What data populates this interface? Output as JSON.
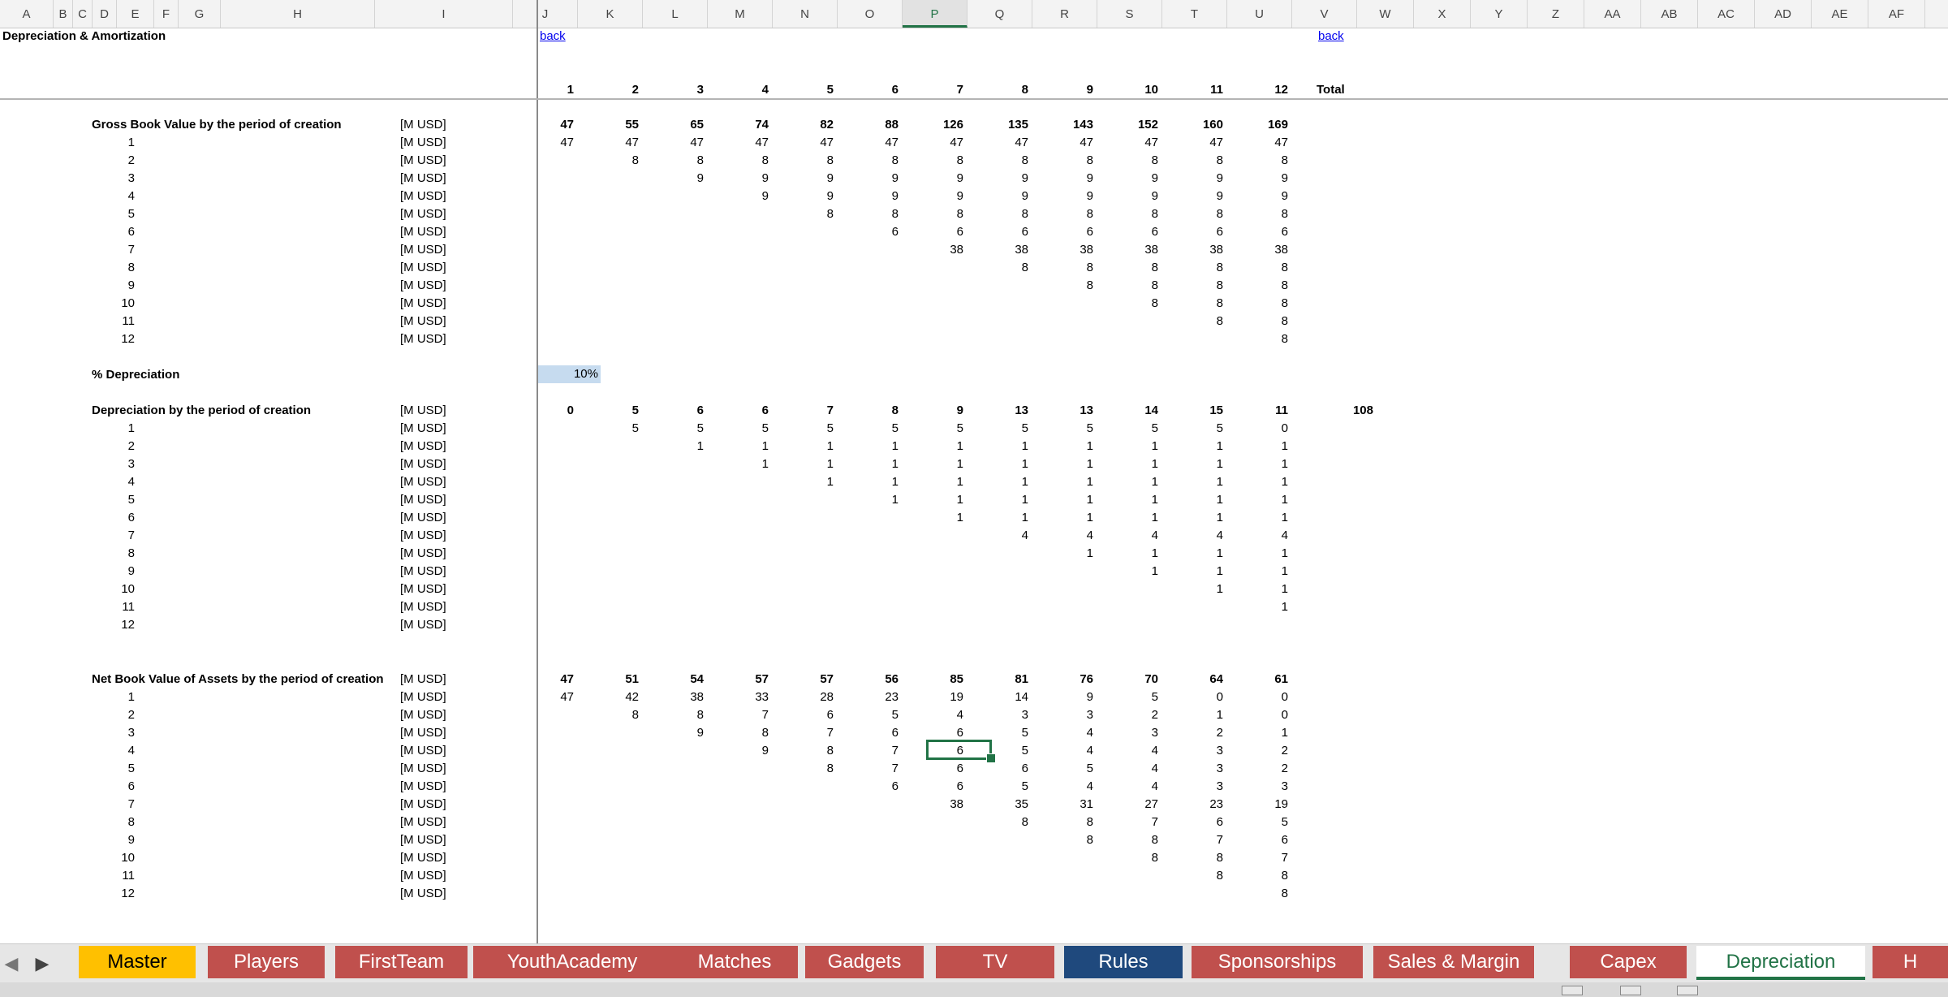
{
  "columns": [
    "A",
    "B",
    "C",
    "D",
    "E",
    "F",
    "G",
    "H",
    "I",
    "J",
    "K",
    "L",
    "M",
    "N",
    "O",
    "P",
    "Q",
    "R",
    "S",
    "T",
    "U",
    "V",
    "W",
    "X",
    "Y",
    "Z",
    "AA",
    "AB",
    "AC",
    "AD",
    "AE",
    "AF"
  ],
  "selected_column": "P",
  "header": {
    "title": "Depreciation & Amortization",
    "back_link_1": "back",
    "back_link_2": "back",
    "periods": [
      "1",
      "2",
      "3",
      "4",
      "5",
      "6",
      "7",
      "8",
      "9",
      "10",
      "11",
      "12"
    ],
    "total_label": "Total"
  },
  "sections": {
    "gross": {
      "title": "Gross Book Value by the period of creation",
      "units": "[M USD]",
      "totals": [
        "47",
        "55",
        "65",
        "74",
        "82",
        "88",
        "126",
        "135",
        "143",
        "152",
        "160",
        "169"
      ],
      "rows": [
        {
          "label": "1",
          "units": "[M USD]",
          "values": [
            "47",
            "47",
            "47",
            "47",
            "47",
            "47",
            "47",
            "47",
            "47",
            "47",
            "47",
            "47"
          ]
        },
        {
          "label": "2",
          "units": "[M USD]",
          "values": [
            "",
            "8",
            "8",
            "8",
            "8",
            "8",
            "8",
            "8",
            "8",
            "8",
            "8",
            "8"
          ]
        },
        {
          "label": "3",
          "units": "[M USD]",
          "values": [
            "",
            "",
            "9",
            "9",
            "9",
            "9",
            "9",
            "9",
            "9",
            "9",
            "9",
            "9"
          ]
        },
        {
          "label": "4",
          "units": "[M USD]",
          "values": [
            "",
            "",
            "",
            "9",
            "9",
            "9",
            "9",
            "9",
            "9",
            "9",
            "9",
            "9"
          ]
        },
        {
          "label": "5",
          "units": "[M USD]",
          "values": [
            "",
            "",
            "",
            "",
            "8",
            "8",
            "8",
            "8",
            "8",
            "8",
            "8",
            "8"
          ]
        },
        {
          "label": "6",
          "units": "[M USD]",
          "values": [
            "",
            "",
            "",
            "",
            "",
            "6",
            "6",
            "6",
            "6",
            "6",
            "6",
            "6"
          ]
        },
        {
          "label": "7",
          "units": "[M USD]",
          "values": [
            "",
            "",
            "",
            "",
            "",
            "",
            "38",
            "38",
            "38",
            "38",
            "38",
            "38"
          ]
        },
        {
          "label": "8",
          "units": "[M USD]",
          "values": [
            "",
            "",
            "",
            "",
            "",
            "",
            "",
            "8",
            "8",
            "8",
            "8",
            "8"
          ]
        },
        {
          "label": "9",
          "units": "[M USD]",
          "values": [
            "",
            "",
            "",
            "",
            "",
            "",
            "",
            "",
            "8",
            "8",
            "8",
            "8"
          ]
        },
        {
          "label": "10",
          "units": "[M USD]",
          "values": [
            "",
            "",
            "",
            "",
            "",
            "",
            "",
            "",
            "",
            "8",
            "8",
            "8"
          ]
        },
        {
          "label": "11",
          "units": "[M USD]",
          "values": [
            "",
            "",
            "",
            "",
            "",
            "",
            "",
            "",
            "",
            "",
            "8",
            "8"
          ]
        },
        {
          "label": "12",
          "units": "[M USD]",
          "values": [
            "",
            "",
            "",
            "",
            "",
            "",
            "",
            "",
            "",
            "",
            "",
            "8"
          ]
        }
      ]
    },
    "pct": {
      "title": "% Depreciation",
      "value": "10%"
    },
    "dep": {
      "title": "Depreciation by the period of creation",
      "units": "[M USD]",
      "totals": [
        "0",
        "5",
        "6",
        "6",
        "7",
        "8",
        "9",
        "13",
        "13",
        "14",
        "15",
        "11"
      ],
      "grand_total": "108",
      "rows": [
        {
          "label": "1",
          "units": "[M USD]",
          "values": [
            "",
            "5",
            "5",
            "5",
            "5",
            "5",
            "5",
            "5",
            "5",
            "5",
            "5",
            "0"
          ]
        },
        {
          "label": "2",
          "units": "[M USD]",
          "values": [
            "",
            "",
            "1",
            "1",
            "1",
            "1",
            "1",
            "1",
            "1",
            "1",
            "1",
            "1"
          ]
        },
        {
          "label": "3",
          "units": "[M USD]",
          "values": [
            "",
            "",
            "",
            "1",
            "1",
            "1",
            "1",
            "1",
            "1",
            "1",
            "1",
            "1"
          ]
        },
        {
          "label": "4",
          "units": "[M USD]",
          "values": [
            "",
            "",
            "",
            "",
            "1",
            "1",
            "1",
            "1",
            "1",
            "1",
            "1",
            "1"
          ]
        },
        {
          "label": "5",
          "units": "[M USD]",
          "values": [
            "",
            "",
            "",
            "",
            "",
            "1",
            "1",
            "1",
            "1",
            "1",
            "1",
            "1"
          ]
        },
        {
          "label": "6",
          "units": "[M USD]",
          "values": [
            "",
            "",
            "",
            "",
            "",
            "",
            "1",
            "1",
            "1",
            "1",
            "1",
            "1"
          ]
        },
        {
          "label": "7",
          "units": "[M USD]",
          "values": [
            "",
            "",
            "",
            "",
            "",
            "",
            "",
            "4",
            "4",
            "4",
            "4",
            "4"
          ]
        },
        {
          "label": "8",
          "units": "[M USD]",
          "values": [
            "",
            "",
            "",
            "",
            "",
            "",
            "",
            "",
            "1",
            "1",
            "1",
            "1"
          ]
        },
        {
          "label": "9",
          "units": "[M USD]",
          "values": [
            "",
            "",
            "",
            "",
            "",
            "",
            "",
            "",
            "",
            "1",
            "1",
            "1"
          ]
        },
        {
          "label": "10",
          "units": "[M USD]",
          "values": [
            "",
            "",
            "",
            "",
            "",
            "",
            "",
            "",
            "",
            "",
            "1",
            "1"
          ]
        },
        {
          "label": "11",
          "units": "[M USD]",
          "values": [
            "",
            "",
            "",
            "",
            "",
            "",
            "",
            "",
            "",
            "",
            "",
            "1"
          ]
        },
        {
          "label": "12",
          "units": "[M USD]",
          "values": [
            "",
            "",
            "",
            "",
            "",
            "",
            "",
            "",
            "",
            "",
            "",
            ""
          ]
        }
      ]
    },
    "net": {
      "title": "Net Book Value of Assets by the period of creation",
      "units": "[M USD]",
      "totals": [
        "47",
        "51",
        "54",
        "57",
        "57",
        "56",
        "85",
        "81",
        "76",
        "70",
        "64",
        "61"
      ],
      "rows": [
        {
          "label": "1",
          "units": "[M USD]",
          "values": [
            "47",
            "42",
            "38",
            "33",
            "28",
            "23",
            "19",
            "14",
            "9",
            "5",
            "0",
            "0"
          ]
        },
        {
          "label": "2",
          "units": "[M USD]",
          "values": [
            "",
            "8",
            "8",
            "7",
            "6",
            "5",
            "4",
            "3",
            "3",
            "2",
            "1",
            "0"
          ]
        },
        {
          "label": "3",
          "units": "[M USD]",
          "values": [
            "",
            "",
            "9",
            "8",
            "7",
            "6",
            "6",
            "5",
            "4",
            "3",
            "2",
            "1"
          ]
        },
        {
          "label": "4",
          "units": "[M USD]",
          "values": [
            "",
            "",
            "",
            "9",
            "8",
            "7",
            "6",
            "5",
            "4",
            "4",
            "3",
            "2"
          ]
        },
        {
          "label": "5",
          "units": "[M USD]",
          "values": [
            "",
            "",
            "",
            "",
            "8",
            "7",
            "6",
            "6",
            "5",
            "4",
            "3",
            "2"
          ]
        },
        {
          "label": "6",
          "units": "[M USD]",
          "values": [
            "",
            "",
            "",
            "",
            "",
            "6",
            "6",
            "5",
            "4",
            "4",
            "3",
            "3"
          ]
        },
        {
          "label": "7",
          "units": "[M USD]",
          "values": [
            "",
            "",
            "",
            "",
            "",
            "",
            "38",
            "35",
            "31",
            "27",
            "23",
            "19"
          ]
        },
        {
          "label": "8",
          "units": "[M USD]",
          "values": [
            "",
            "",
            "",
            "",
            "",
            "",
            "",
            "8",
            "8",
            "7",
            "6",
            "5"
          ]
        },
        {
          "label": "9",
          "units": "[M USD]",
          "values": [
            "",
            "",
            "",
            "",
            "",
            "",
            "",
            "",
            "8",
            "8",
            "7",
            "6"
          ]
        },
        {
          "label": "10",
          "units": "[M USD]",
          "values": [
            "",
            "",
            "",
            "",
            "",
            "",
            "",
            "",
            "",
            "8",
            "8",
            "7"
          ]
        },
        {
          "label": "11",
          "units": "[M USD]",
          "values": [
            "",
            "",
            "",
            "",
            "",
            "",
            "",
            "",
            "",
            "",
            "8",
            "8"
          ]
        },
        {
          "label": "12",
          "units": "[M USD]",
          "values": [
            "",
            "",
            "",
            "",
            "",
            "",
            "",
            "",
            "",
            "",
            "",
            "8"
          ]
        }
      ]
    }
  },
  "sheet_tabs": [
    {
      "label": "Master",
      "color": "#ffc000",
      "text_color": "#000000"
    },
    {
      "label": "Players",
      "color": "#c0504d",
      "text_color": "#ffffff"
    },
    {
      "label": "FirstTeam",
      "color": "#c0504d",
      "text_color": "#ffffff"
    },
    {
      "label": "YouthAcademy",
      "color": "#c0504d",
      "text_color": "#ffffff"
    },
    {
      "label": "Matches",
      "color": "#c0504d",
      "text_color": "#ffffff"
    },
    {
      "label": "Gadgets",
      "color": "#c0504d",
      "text_color": "#ffffff"
    },
    {
      "label": "TV",
      "color": "#c0504d",
      "text_color": "#ffffff"
    },
    {
      "label": "Rules",
      "color": "#1f497d",
      "text_color": "#ffffff"
    },
    {
      "label": "Sponsorships",
      "color": "#c0504d",
      "text_color": "#ffffff"
    },
    {
      "label": "Sales & Margin",
      "color": "#c0504d",
      "text_color": "#ffffff"
    },
    {
      "label": "Capex",
      "color": "#c0504d",
      "text_color": "#ffffff"
    },
    {
      "label": "Depreciation",
      "color": "#ffffff",
      "text_color": "#217346",
      "active": true
    },
    {
      "label": "H",
      "color": "#c0504d",
      "text_color": "#ffffff"
    }
  ],
  "icons": {
    "prev": "triangle-left",
    "next": "triangle-right"
  }
}
